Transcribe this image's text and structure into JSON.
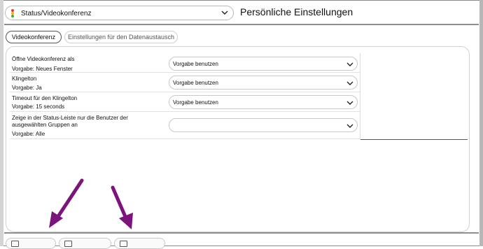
{
  "header": {
    "module_select": {
      "selected": "Status/Videokonferenz"
    },
    "title": "Persönliche Einstellungen"
  },
  "tabs": [
    {
      "label": "Videokonferenz",
      "active": true
    },
    {
      "label": "Einstellungen für den Datenaustausch",
      "active": false
    }
  ],
  "settings": [
    {
      "label": "Öffne Videokonferenz als",
      "default": "Vorgabe: Neues Fenster",
      "value": "Vorgabe benutzen"
    },
    {
      "label": "Klingelton",
      "default": "Vorgabe: Ja",
      "value": "Vorgabe benutzen"
    },
    {
      "label": "Timeout für den Klingelton",
      "default": "Vorgabe: 15 seconds",
      "value": "Vorgabe benutzen"
    },
    {
      "label": "Zeige in der Status-Leiste nur die Benutzer der",
      "label2": "ausgewählten Gruppen an",
      "default": "Vorgabe: Alle",
      "value": ""
    }
  ],
  "icons": {
    "traffic_light": "traffic-light-icon",
    "chevron": "chevron-down-icon",
    "bottom_tab": "window-icon"
  },
  "colors": {
    "annotation_arrow": "#7b147b",
    "traffic_red": "#e53935",
    "traffic_yellow": "#f5b400",
    "traffic_green": "#3cae45"
  }
}
